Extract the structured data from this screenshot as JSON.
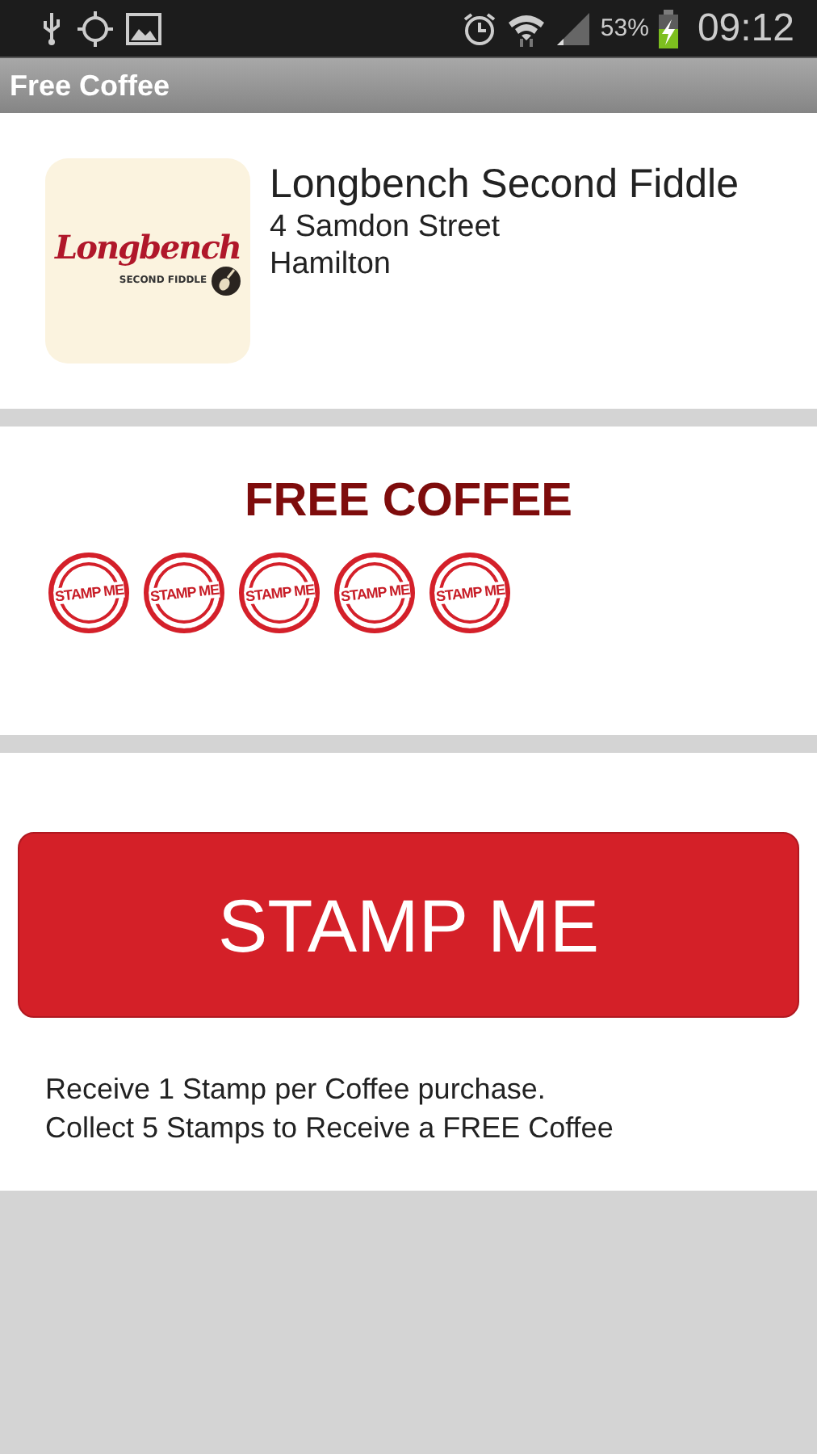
{
  "status_bar": {
    "battery_text": "53%",
    "time": "09:12"
  },
  "app_bar": {
    "title": "Free Coffee"
  },
  "venue": {
    "logo_title": "Longbench",
    "logo_subtitle": "SECOND FIDDLE",
    "name": "Longbench Second Fiddle",
    "address_lines": [
      "4 Samdon Street",
      "Hamilton"
    ]
  },
  "card": {
    "title": "FREE COFFEE",
    "stamps": [
      {
        "label": "STAMP ME"
      },
      {
        "label": "STAMP ME"
      },
      {
        "label": "STAMP ME"
      },
      {
        "label": "STAMP ME"
      },
      {
        "label": "STAMP ME"
      }
    ]
  },
  "action": {
    "button": "STAMP ME",
    "info_lines": [
      "Receive 1 Stamp per Coffee purchase.",
      "Collect 5 Stamps to Receive a FREE Coffee"
    ]
  }
}
